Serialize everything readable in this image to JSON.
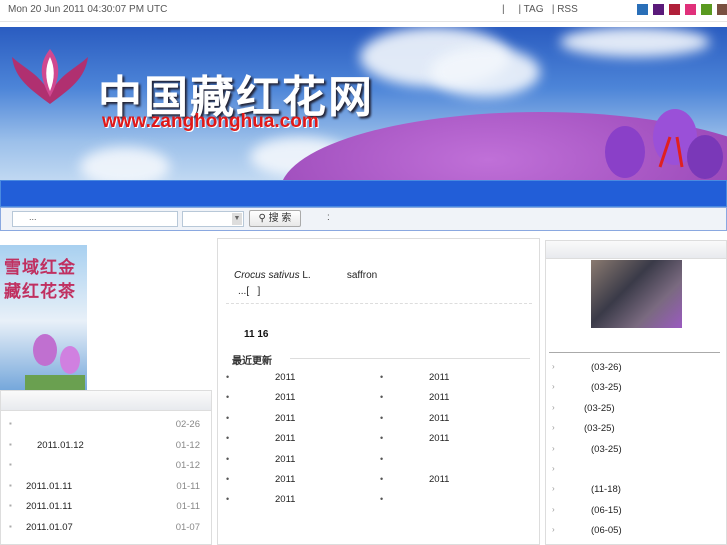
{
  "topbar": {
    "datetime": "Mon 20 Jun 2011 04:30:07 PM UTC",
    "links": "|     | TAG   | RSS",
    "swatches": [
      "#2a6fb8",
      "#5a1a7a",
      "#b0203a",
      "#e0307a",
      "#5a9a20",
      "#7a5040"
    ]
  },
  "banner": {
    "site_name": "中国藏红花网",
    "url": "www.zanghonghua.com"
  },
  "search": {
    "placeholder": "...",
    "button": "搜 索",
    "colon": ":"
  },
  "left": {
    "promo_text": [
      "雪域红金",
      "藏红花茶"
    ],
    "items": [
      {
        "text": "",
        "date": "02-26"
      },
      {
        "text": "2011.01.12",
        "date": "01-12"
      },
      {
        "text": "",
        "date": "01-12"
      },
      {
        "text": "2011.01.11",
        "date": "01-11"
      },
      {
        "text": "2011.01.11",
        "date": "01-11"
      },
      {
        "text": "2011.01.07",
        "date": "01-07"
      }
    ]
  },
  "main": {
    "intro_latin": "Crocus sativus",
    "intro_l": " L.",
    "intro_en": "saffron",
    "more": "...[   ]",
    "count": "11  16",
    "recent_title": "最近更新",
    "col1": [
      "2011",
      "2011",
      "2011",
      "2011",
      "2011",
      "2011",
      "2011"
    ],
    "col2": [
      "2011",
      "2011",
      "2011",
      "2011",
      "",
      "2011",
      ""
    ]
  },
  "right": {
    "items": [
      "(03-26)",
      "(03-25)",
      "(03-25)",
      "(03-25)",
      "(03-25)",
      "",
      "(11-18)",
      "(06-15)",
      "(06-05)"
    ]
  }
}
